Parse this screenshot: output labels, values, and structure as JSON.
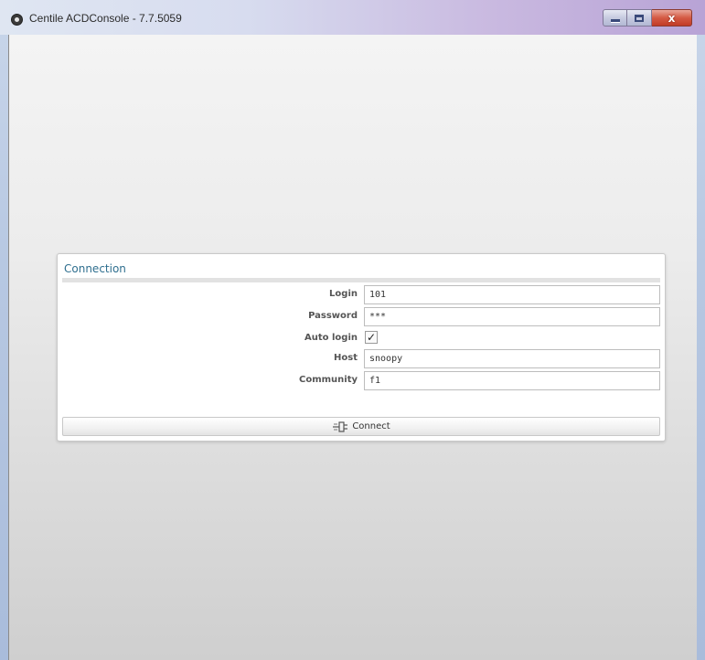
{
  "window": {
    "title": "Centile ACDConsole - 7.7.5059",
    "controls": {
      "minimize": "minimize-icon",
      "maximize": "maximize-icon",
      "close_label": "x"
    }
  },
  "connection": {
    "title": "Connection",
    "fields": {
      "login": {
        "label": "Login",
        "value": "101"
      },
      "password": {
        "label": "Password",
        "value": "***"
      },
      "auto_login": {
        "label": "Auto login",
        "checked": true,
        "mark": "✓"
      },
      "host": {
        "label": "Host",
        "value": "snoopy"
      },
      "community": {
        "label": "Community",
        "value": "f1"
      }
    },
    "connect_button": {
      "label": "Connect",
      "icon": "plug-icon"
    }
  },
  "colors": {
    "panel_title": "#2f6f8f",
    "close_button": "#d45a44"
  }
}
